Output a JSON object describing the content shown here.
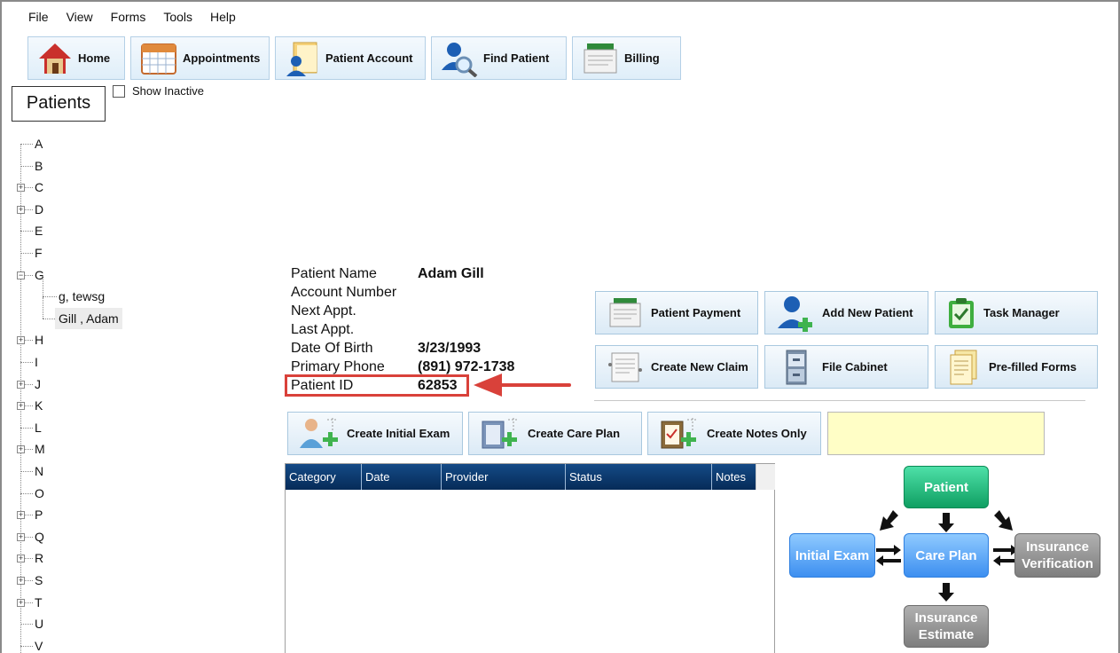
{
  "menu": {
    "items": [
      "File",
      "View",
      "Forms",
      "Tools",
      "Help"
    ]
  },
  "toolbar": {
    "home": "Home",
    "appointments": "Appointments",
    "patient_account": "Patient Account",
    "find_patient": "Find Patient",
    "billing": "Billing"
  },
  "patients": {
    "title": "Patients",
    "show_inactive": "Show Inactive",
    "show_inactive_checked": false,
    "tree": [
      {
        "label": "A",
        "expandable": false
      },
      {
        "label": "B",
        "expandable": false
      },
      {
        "label": "C",
        "expandable": true
      },
      {
        "label": "D",
        "expandable": true
      },
      {
        "label": "E",
        "expandable": false
      },
      {
        "label": "F",
        "expandable": false
      },
      {
        "label": "G",
        "expandable": true,
        "expanded": true,
        "children": [
          "g, tewsg",
          "Gill , Adam"
        ]
      },
      {
        "label": "H",
        "expandable": true
      },
      {
        "label": "I",
        "expandable": false
      },
      {
        "label": "J",
        "expandable": true
      },
      {
        "label": "K",
        "expandable": true
      },
      {
        "label": "L",
        "expandable": false
      },
      {
        "label": "M",
        "expandable": true
      },
      {
        "label": "N",
        "expandable": false
      },
      {
        "label": "O",
        "expandable": false
      },
      {
        "label": "P",
        "expandable": true
      },
      {
        "label": "Q",
        "expandable": true
      },
      {
        "label": "R",
        "expandable": true
      },
      {
        "label": "S",
        "expandable": true
      },
      {
        "label": "T",
        "expandable": true
      },
      {
        "label": "U",
        "expandable": false
      },
      {
        "label": "V",
        "expandable": false
      }
    ],
    "selected": "Gill , Adam"
  },
  "patient_info": {
    "name_label": "Patient Name",
    "name_value": "Adam  Gill",
    "account_label": "Account Number",
    "account_value": "",
    "next_label": "Next Appt.",
    "next_value": "",
    "last_label": "Last Appt.",
    "last_value": "",
    "dob_label": "Date Of Birth",
    "dob_value": "3/23/1993",
    "phone_label": "Primary Phone",
    "phone_value": "(891) 972-1738",
    "id_label": "Patient ID",
    "id_value": "62853"
  },
  "actions": {
    "patient_payment": "Patient Payment",
    "add_new_patient": "Add New Patient",
    "task_manager": "Task Manager",
    "create_new_claim": "Create New Claim",
    "file_cabinet": "File Cabinet",
    "prefilled_forms": "Pre-filled Forms"
  },
  "exam_buttons": {
    "initial_exam": "Create Initial Exam",
    "care_plan": "Create Care Plan",
    "notes_only": "Create Notes Only"
  },
  "grid": {
    "columns": [
      "Category",
      "Date",
      "Provider",
      "Status",
      "Notes"
    ]
  },
  "flow": {
    "patient": "Patient",
    "initial_exam": "Initial Exam",
    "care_plan": "Care Plan",
    "insurance_verification_1": "Insurance",
    "insurance_verification_2": "Verification",
    "insurance_estimate_1": "Insurance",
    "insurance_estimate_2": "Estimate"
  },
  "colors": {
    "highlight": "#d9413a",
    "grid_header": "#0d3b70",
    "note_bg": "#fffec6"
  }
}
